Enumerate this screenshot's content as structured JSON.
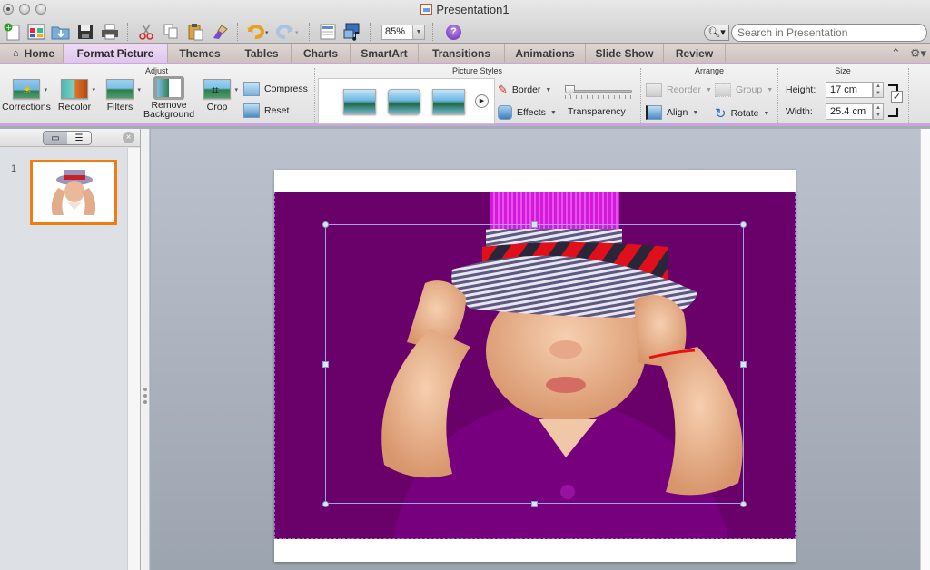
{
  "window": {
    "title": "Presentation1",
    "controls": [
      "close",
      "minimize",
      "zoom"
    ]
  },
  "toolbar": {
    "icons": [
      "new-icon",
      "gallery-icon",
      "open-icon",
      "save-icon",
      "print-icon",
      "cut-icon",
      "copy-icon",
      "paste-icon",
      "format-painter-icon",
      "undo-icon",
      "redo-icon",
      "slide-layout-icon",
      "media-icon",
      "help-icon"
    ],
    "zoom_value": "85%",
    "help_label": "?"
  },
  "search": {
    "placeholder": "Search in Presentation",
    "value": ""
  },
  "tabs": [
    {
      "label": "Home",
      "active": false
    },
    {
      "label": "Format Picture",
      "active": true
    },
    {
      "label": "Themes",
      "active": false
    },
    {
      "label": "Tables",
      "active": false
    },
    {
      "label": "Charts",
      "active": false
    },
    {
      "label": "SmartArt",
      "active": false
    },
    {
      "label": "Transitions",
      "active": false
    },
    {
      "label": "Animations",
      "active": false
    },
    {
      "label": "Slide Show",
      "active": false
    },
    {
      "label": "Review",
      "active": false
    }
  ],
  "ribbon": {
    "groups": {
      "adjust": "Adjust",
      "picture_styles": "Picture Styles",
      "arrange": "Arrange",
      "size": "Size"
    },
    "adjust": {
      "corrections": "Corrections",
      "recolor": "Recolor",
      "filters": "Filters",
      "remove_background_1": "Remove",
      "remove_background_2": "Background",
      "crop": "Crop",
      "compress": "Compress",
      "reset": "Reset"
    },
    "picture_styles": {
      "border": "Border",
      "effects": "Effects",
      "transparency": "Transparency",
      "transparency_value": 0
    },
    "arrange": {
      "reorder": "Reorder",
      "group": "Group",
      "align": "Align",
      "rotate": "Rotate"
    },
    "size": {
      "height_label": "Height:",
      "height_value": "17 cm",
      "width_label": "Width:",
      "width_value": "25.4 cm",
      "lock_aspect": true,
      "lock_mark": "✓"
    }
  },
  "slides_pane": {
    "view_normal": "▭",
    "view_outline": "☰",
    "close": "×",
    "slides": [
      {
        "number": "1",
        "selected": true
      }
    ]
  },
  "colors": {
    "accent_ribbon": "#c9a6dc",
    "slide_selected": "#f07d12",
    "photo_background": "#6a006a"
  }
}
